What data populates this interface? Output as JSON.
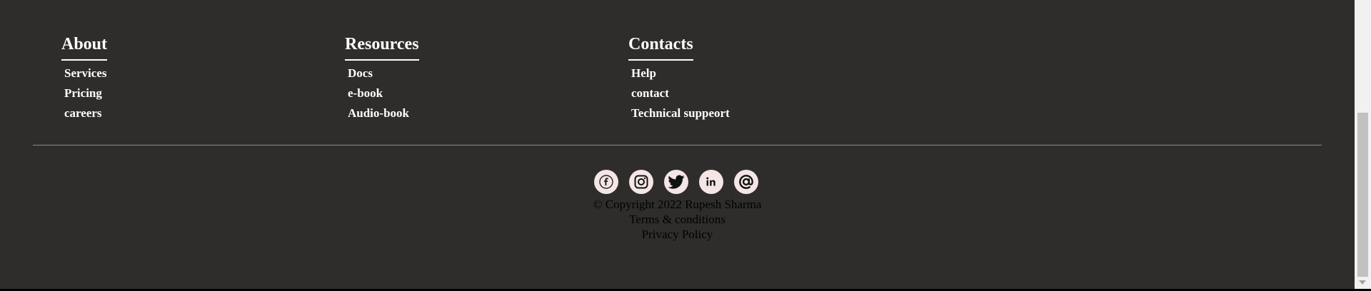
{
  "footer": {
    "columns": [
      {
        "title": "About",
        "links": [
          "Services",
          "Pricing",
          "careers"
        ]
      },
      {
        "title": "Resources",
        "links": [
          "Docs",
          "e-book",
          "Audio-book"
        ]
      },
      {
        "title": "Contacts",
        "links": [
          "Help",
          "contact",
          "Technical suppeort"
        ]
      }
    ],
    "social": [
      {
        "icon": "facebook-icon"
      },
      {
        "icon": "instagram-icon"
      },
      {
        "icon": "twitter-icon"
      },
      {
        "icon": "linkedin-icon"
      },
      {
        "icon": "email-icon"
      }
    ],
    "copyright": "© Copyright 2022 Rupesh Sharma",
    "terms": "Terms & conditions",
    "privacy": "Privacy Policy"
  },
  "colors": {
    "background": "#2f2d2c",
    "text": "#ffffff",
    "icon_bg": "#f5e6e6"
  }
}
